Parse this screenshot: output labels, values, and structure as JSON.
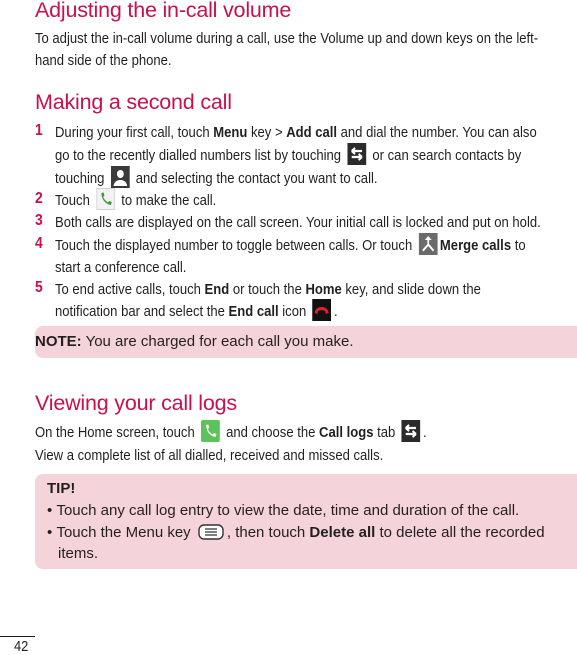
{
  "sections": {
    "volume": {
      "title": "Adjusting the in-call volume",
      "line1": "To adjust the in-call volume during a call, use the Volume up and down keys on the left-",
      "line2": "hand side of the phone."
    },
    "second_call": {
      "title": "Making a second call",
      "steps": [
        {
          "num": "1",
          "a1": "During your first call, touch ",
          "b1": "Menu",
          "a2": " key > ",
          "b2": "Add call",
          "a3": " and dial the number. You can also",
          "l2a": "go to the recently dialled numbers list by touching ",
          "l2b": " or can search contacts by",
          "l3a": "touching ",
          "l3b": " and selecting the contact you want to call."
        },
        {
          "num": "2",
          "a1": "Touch ",
          "a2": " to make the call."
        },
        {
          "num": "3",
          "a1": "Both calls are displayed on the call screen. Your initial call is locked and put on hold."
        },
        {
          "num": "4",
          "a1": "Touch the displayed number to toggle between calls. Or touch ",
          "b1": "Merge calls",
          "a2": " to",
          "l2": "start a conference call."
        },
        {
          "num": "5",
          "a1": "To end active calls, touch ",
          "b1": "End",
          "a2": " or touch the ",
          "b2": "Home",
          "a3": " key, and slide down the",
          "l2a": "notification bar and select the ",
          "l2b": "End call",
          "l2c": " icon ",
          "l2d": "."
        }
      ]
    },
    "note": {
      "label": "NOTE:",
      "text": " You are charged for each call you make."
    },
    "call_logs": {
      "title": "Viewing your call logs",
      "line1a": "On the Home screen, touch ",
      "line1b": " and choose the ",
      "line1c": "Call logs",
      "line1d": " tab ",
      "line1e": ".",
      "line2": "View a complete list of all dialled, received and missed calls."
    },
    "tip": {
      "label": "TIP!",
      "bullet": "•",
      "item1": "Touch any call log entry to view the date, time and duration of the call.",
      "item2a": "Touch the Menu key ",
      "item2b": ", then touch ",
      "item2c": "Delete all",
      "item2d": " to delete all the recorded",
      "item2e": "items."
    }
  },
  "page_number": "42",
  "colors": {
    "heading": "#c8104e",
    "box": "#f5d3da"
  }
}
